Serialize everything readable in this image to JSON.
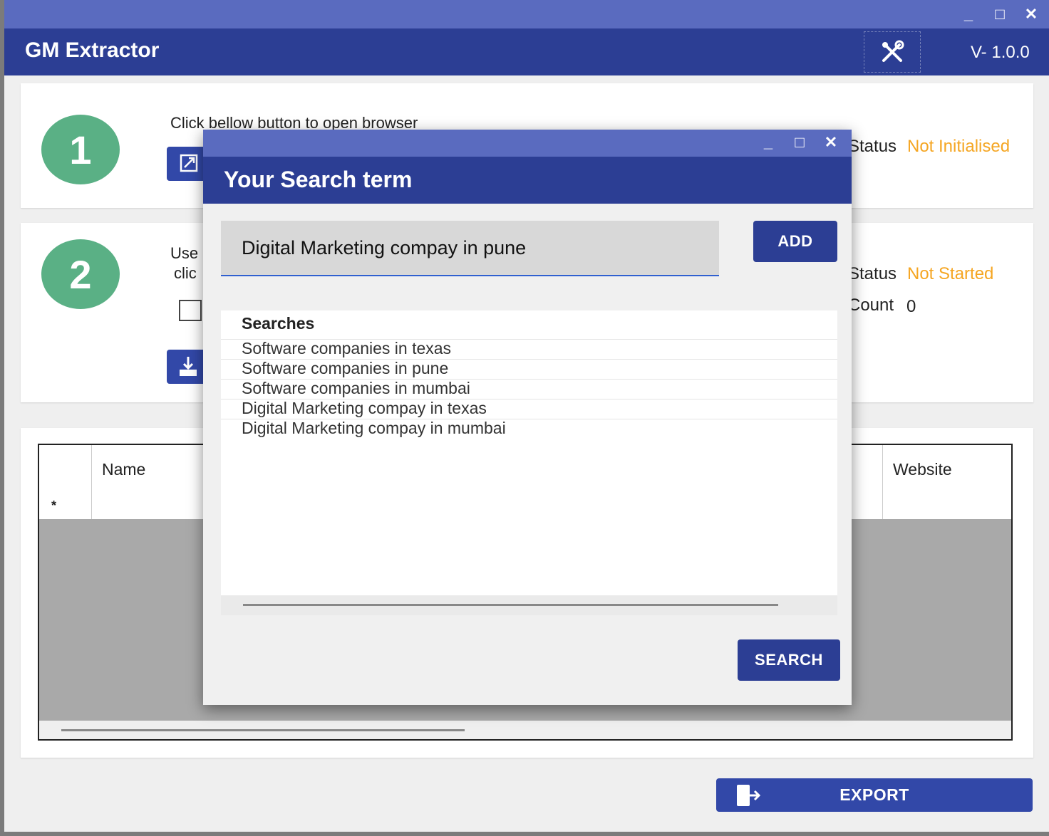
{
  "window": {
    "title": "GM Extractor",
    "version": "V- 1.0.0",
    "controls": {
      "minimize": "_",
      "maximize": "□",
      "close": "✕"
    }
  },
  "step1": {
    "number": "1",
    "instruction": "Click bellow button to open browser",
    "status_label": "Status",
    "status_value": "Not Initialised"
  },
  "step2": {
    "number": "2",
    "instruction_a": "Use",
    "instruction_b": "clic",
    "status_label": "Status",
    "status_value": "Not Started",
    "count_label": "Count",
    "count_value": "0"
  },
  "grid": {
    "columns": [
      "Name",
      "Website"
    ],
    "new_row_marker": "*"
  },
  "export": {
    "label": "EXPORT"
  },
  "dialog": {
    "title": "Your Search term",
    "controls": {
      "minimize": "_",
      "maximize": "□",
      "close": "✕"
    },
    "term_input_value": "Digital Marketing compay in pune",
    "add_label": "ADD",
    "list_header": "Searches",
    "searches": [
      "Software companies in texas",
      "Software companies in pune",
      "Software companies in mumbai",
      "Digital Marketing compay in texas",
      "Digital Marketing compay in mumbai"
    ],
    "search_label": "SEARCH"
  },
  "colors": {
    "header": "#2c3e94",
    "chrome": "#5a6bbf",
    "step_badge": "#5ab085",
    "status_value": "#f5a623"
  },
  "icons": {
    "tools": "tools-icon",
    "open_browser": "external-link-icon",
    "download": "download-icon",
    "export": "export-icon"
  }
}
